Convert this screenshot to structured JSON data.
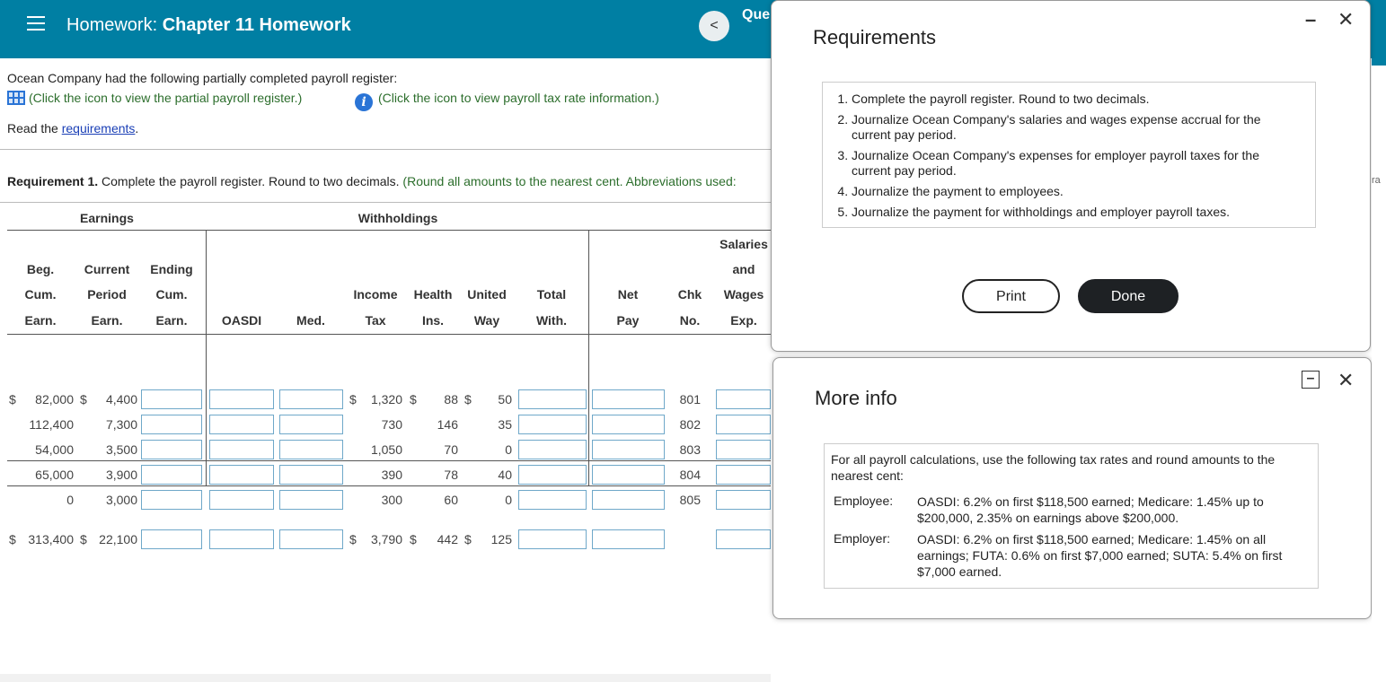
{
  "header": {
    "title_prefix": "Homework:",
    "title_main": "Chapter 11 Homework",
    "back_label": "<",
    "question_label": "Que"
  },
  "problem": {
    "intro": "Ocean Company had the following partially completed payroll register:",
    "link_register": "(Click the icon to view the partial payroll register.)",
    "link_tax": "(Click the icon to view payroll tax rate information.)",
    "read_prefix": "Read the ",
    "read_link": "requirements",
    "read_suffix": ".",
    "req1_bold": "Requirement 1.",
    "req1_text": " Complete the payroll register. Round to two decimals. ",
    "req1_green": "(Round all amounts to the nearest cent. Abbreviations used:"
  },
  "register": {
    "group_earnings": "Earnings",
    "group_withholdings": "Withholdings",
    "col_beg": [
      "Beg.",
      "Cum.",
      "Earn."
    ],
    "col_current": [
      "Current",
      "Period",
      "Earn."
    ],
    "col_ending": [
      "Ending",
      "Cum.",
      "Earn."
    ],
    "col_oasdi": "OASDI",
    "col_med": "Med.",
    "col_income": [
      "Income",
      "Tax"
    ],
    "col_health": [
      "Health",
      "Ins."
    ],
    "col_united": [
      "United",
      "Way"
    ],
    "col_total": [
      "Total",
      "With."
    ],
    "col_net": [
      "Net",
      "Pay"
    ],
    "col_chk": [
      "Chk",
      "No."
    ],
    "col_salaries": [
      "Salaries",
      "and",
      "Wages",
      "Exp."
    ],
    "rows": [
      {
        "beg": "82,000",
        "current": "4,400",
        "income": "1,320",
        "health": "88",
        "united": "50",
        "chk": "801",
        "dollar": "$"
      },
      {
        "beg": "112,400",
        "current": "7,300",
        "income": "730",
        "health": "146",
        "united": "35",
        "chk": "802",
        "dollar": ""
      },
      {
        "beg": "54,000",
        "current": "3,500",
        "income": "1,050",
        "health": "70",
        "united": "0",
        "chk": "803",
        "dollar": ""
      },
      {
        "beg": "65,000",
        "current": "3,900",
        "income": "390",
        "health": "78",
        "united": "40",
        "chk": "804",
        "dollar": ""
      },
      {
        "beg": "0",
        "current": "3,000",
        "income": "300",
        "health": "60",
        "united": "0",
        "chk": "805",
        "dollar": ""
      }
    ],
    "totals": {
      "beg": "313,400",
      "current": "22,100",
      "income": "3,790",
      "health": "442",
      "united": "125",
      "dollar": "$"
    }
  },
  "requirements_modal": {
    "title": "Requirements",
    "minimize": "–",
    "close": "✕",
    "items": [
      "Complete the payroll register. Round to two decimals.",
      "Journalize Ocean Company's salaries and wages expense accrual for the current pay period.",
      "Journalize Ocean Company's expenses for employer payroll taxes for the current pay period.",
      "Journalize the payment to employees.",
      "Journalize the payment for withholdings and employer payroll taxes."
    ],
    "print_label": "Print",
    "done_label": "Done"
  },
  "info_modal": {
    "title": "More info",
    "minimize": "–",
    "close": "✕",
    "intro": "For all payroll calculations, use the following tax rates and round amounts to the nearest cent:",
    "employee_label": "Employee:",
    "employee_text": "OASDI: 6.2% on first $118,500 earned; Medicare: 1.45% up to $200,000, 2.35% on earnings above $200,000.",
    "employer_label": "Employer:",
    "employer_text": "OASDI: 6.2% on first $118,500 earned; Medicare: 1.45% on all earnings; FUTA: 0.6% on first $7,000 earned; SUTA: 5.4% on first $7,000 earned."
  },
  "edge_text": "ra"
}
